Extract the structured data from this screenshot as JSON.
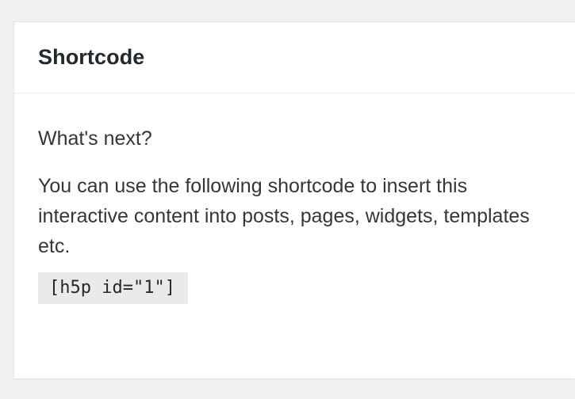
{
  "box": {
    "title": "Shortcode"
  },
  "content": {
    "next_heading": "What's next?",
    "description": "You can use the following shortcode to insert this interactive content into posts, pages, widgets, templates etc.",
    "shortcode": "[h5p id=\"1\"]"
  },
  "colors": {
    "page_background": "#f1f1f1",
    "box_background": "#ffffff",
    "code_background": "#eaeaea",
    "text": "#32373c"
  }
}
